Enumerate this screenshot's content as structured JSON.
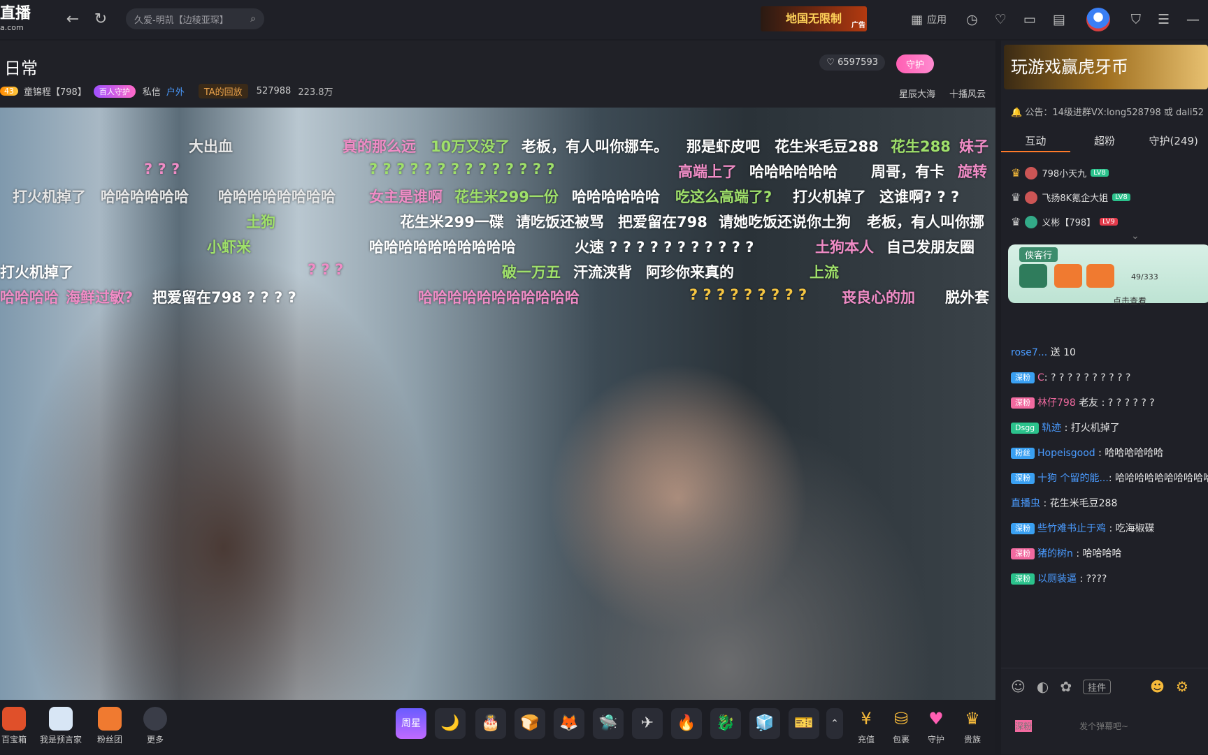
{
  "topbar": {
    "logo_text": "直播",
    "logo_sub": "a.com",
    "search_query": "久爱-明凯【边稜亚琛】",
    "ad_text": "地国无限制",
    "ad_tag": "广告",
    "apps_label": "应用"
  },
  "header": {
    "title": "日常",
    "level": "43",
    "anchor_name": "童锦程【798】",
    "guard_badge": "百人守护",
    "message_label": "私信",
    "category": "户外",
    "replay_label": "TA的回放",
    "room_id": "527988",
    "followers": "223.8万",
    "hot_value": "6597593",
    "guard_button": "守护",
    "link1": "星辰大海",
    "link2": "十播风云"
  },
  "danmaku": [
    {
      "text": "大出血",
      "color": "#e6e6e6"
    },
    {
      "text": "真的那么远",
      "color": "#f08cc6"
    },
    {
      "text": "10万又没了",
      "color": "#9fe06a"
    },
    {
      "text": "老板，有人叫你挪车。",
      "color": "#ffffff"
    },
    {
      "text": "那是虾皮吧",
      "color": "#ffffff"
    },
    {
      "text": "花生米毛豆288",
      "color": "#ffffff"
    },
    {
      "text": "花生288",
      "color": "#9fe06a"
    },
    {
      "text": "妹子",
      "color": "#f08cc6"
    },
    {
      "text": "? ? ?",
      "color": "#f08cc6"
    },
    {
      "text": "? ? ? ? ? ? ? ? ? ? ? ? ? ?",
      "color": "#9fe06a"
    },
    {
      "text": "高端上了",
      "color": "#f08cc6"
    },
    {
      "text": "哈哈哈哈哈哈",
      "color": "#ffffff"
    },
    {
      "text": "周哥，有卡",
      "color": "#ffffff"
    },
    {
      "text": "旋转",
      "color": "#f08cc6"
    },
    {
      "text": "打火机掉了",
      "color": "#e6e6e6"
    },
    {
      "text": "哈哈哈哈哈哈",
      "color": "#e6e6e6"
    },
    {
      "text": "哈哈哈哈哈哈哈哈",
      "color": "#e6e6e6"
    },
    {
      "text": "女主是谁啊",
      "color": "#f08cc6"
    },
    {
      "text": "花生米299一份",
      "color": "#9fe06a"
    },
    {
      "text": "哈哈哈哈哈哈",
      "color": "#ffffff"
    },
    {
      "text": "吃这么高端了?",
      "color": "#9fe06a"
    },
    {
      "text": "打火机掉了",
      "color": "#ffffff"
    },
    {
      "text": "这谁啊? ? ?",
      "color": "#ffffff"
    },
    {
      "text": "土狗",
      "color": "#9fe06a"
    },
    {
      "text": "花生米299一碟",
      "color": "#ffffff"
    },
    {
      "text": "请吃饭还被骂",
      "color": "#ffffff"
    },
    {
      "text": "把爱留在798",
      "color": "#ffffff"
    },
    {
      "text": "请她吃饭还说你土狗",
      "color": "#ffffff"
    },
    {
      "text": "老板，有人叫你挪",
      "color": "#ffffff"
    },
    {
      "text": "小虾米",
      "color": "#9fe06a"
    },
    {
      "text": "哈哈哈哈哈哈哈哈哈哈",
      "color": "#ffffff"
    },
    {
      "text": "火速 ? ? ? ? ? ? ? ? ? ? ?",
      "color": "#ffffff"
    },
    {
      "text": "土狗本人",
      "color": "#f08cc6"
    },
    {
      "text": "自己发朋友圈",
      "color": "#ffffff"
    },
    {
      "text": "打火机掉了",
      "color": "#ffffff"
    },
    {
      "text": "? ? ?",
      "color": "#f08cc6"
    },
    {
      "text": "破一万五",
      "color": "#9fe06a"
    },
    {
      "text": "汗流浃背",
      "color": "#ffffff"
    },
    {
      "text": "阿珍你来真的",
      "color": "#ffffff"
    },
    {
      "text": "上流",
      "color": "#9fe06a"
    },
    {
      "text": "哈哈哈哈",
      "color": "#f08cc6"
    },
    {
      "text": "海鲜过敏?",
      "color": "#f08cc6"
    },
    {
      "text": "把爱留在798 ? ? ? ?",
      "color": "#ffffff"
    },
    {
      "text": "哈哈哈哈哈哈哈哈哈哈哈",
      "color": "#f08cc6"
    },
    {
      "text": "? ? ? ? ? ? ? ? ?",
      "color": "#f5c542"
    },
    {
      "text": "丧良心的加",
      "color": "#f08cc6"
    },
    {
      "text": "脱外套",
      "color": "#ffffff"
    }
  ],
  "bottombar": {
    "left_items": [
      "百宝箱",
      "我是预言家",
      "粉丝团",
      "更多"
    ],
    "gift_label": "周星",
    "right_items": [
      "充值",
      "包裹",
      "守护",
      "贵族"
    ]
  },
  "panel": {
    "ad_text": "玩游戏赢虎牙币",
    "notice": "公告：14级进群VX:long528798 或 dali52",
    "tabs": [
      "互动",
      "超粉",
      "守护(249)"
    ],
    "guards": [
      {
        "name": "798小天九",
        "badge": "LV8"
      },
      {
        "name": "飞扬8K氪企大姐",
        "badge": "LV8"
      },
      {
        "name": "义彬【798】",
        "badge": "LV9"
      }
    ],
    "task_title": "侠客行",
    "task_progress": "49/333",
    "task_more": "点击查看",
    "chat": [
      {
        "name": "rose7...",
        "badge": "",
        "text": "送  10",
        "bcolor": "blue"
      },
      {
        "name": "C",
        "badge": "深粉",
        "text": "? ? ? ? ? ? ? ? ? ?",
        "bcolor": "blue"
      },
      {
        "name": "林仔798",
        "badge": "深粉",
        "text": "老友 : ? ? ? ? ? ?",
        "bcolor": "pink"
      },
      {
        "name": "轨迹",
        "badge": "Dsgg",
        "text": "打火机掉了",
        "bcolor": "green"
      },
      {
        "name": "Hopeisgood",
        "badge": "粉丝",
        "text": "哈哈哈哈哈哈",
        "bcolor": "blue"
      },
      {
        "name": "十狗  个留的能...",
        "badge": "深粉",
        "text": "哈哈哈哈哈哈哈哈哈哈",
        "bcolor": "blue"
      },
      {
        "name": "直播虫",
        "badge": "",
        "text": "花生米毛豆288",
        "bcolor": "blue"
      },
      {
        "name": "些竹难书止于鸡",
        "badge": "深粉",
        "text": "吃海椒碟",
        "bcolor": "blue"
      },
      {
        "name": "猪的树n",
        "badge": "深粉",
        "text": "哈哈哈哈",
        "bcolor": "pink"
      },
      {
        "name": "以厕装逼",
        "badge": "深粉",
        "text": "????",
        "bcolor": "green"
      }
    ],
    "hang_label": "挂件",
    "input_badge": "深粉",
    "input_placeholder": "发个弹幕吧~"
  }
}
